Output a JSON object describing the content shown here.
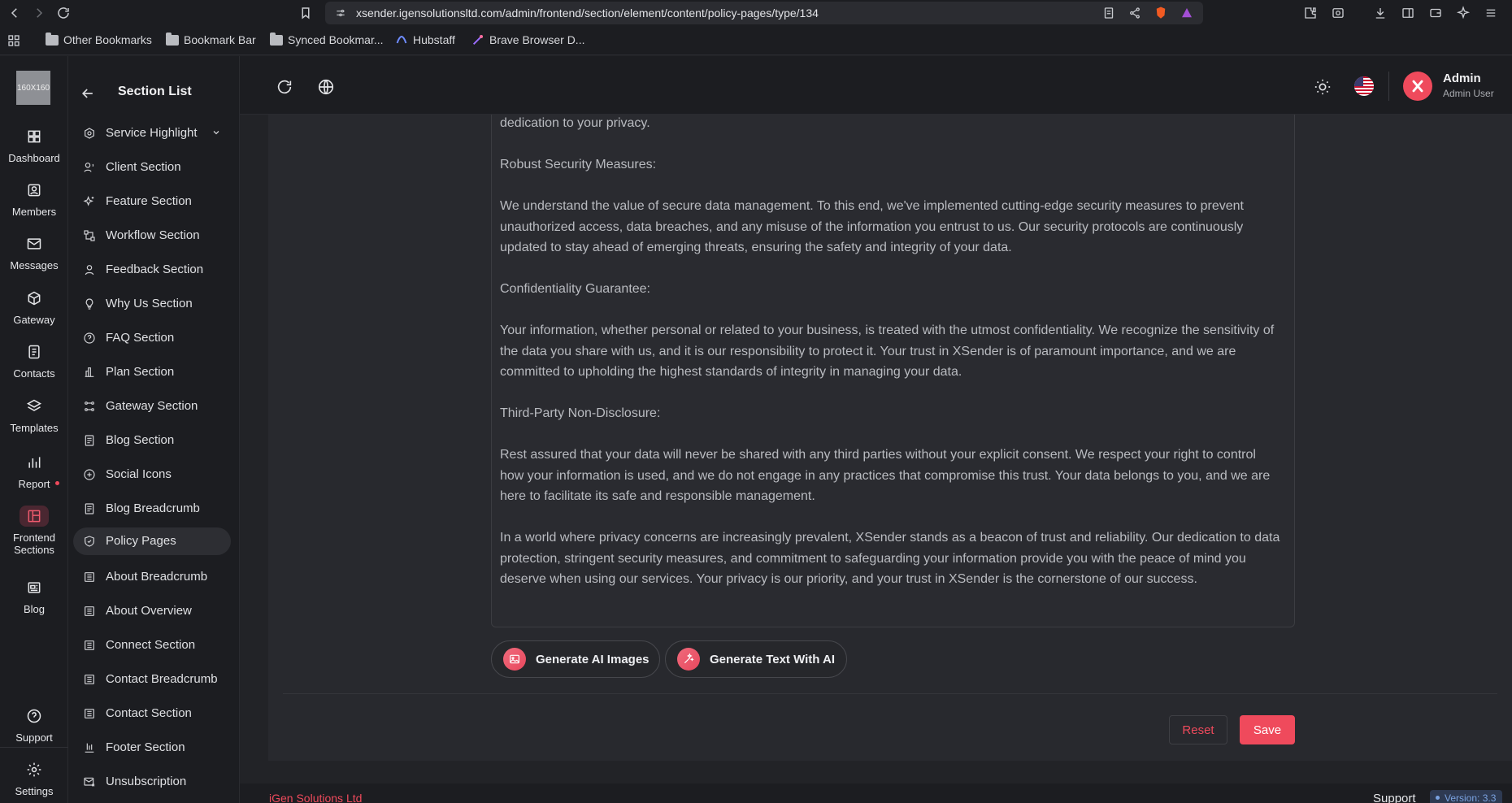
{
  "browser": {
    "url": "xsender.igensolutionsltd.com/admin/frontend/section/element/content/policy-pages/type/134",
    "bookmarks": [
      "Other Bookmarks",
      "Bookmark Bar",
      "Synced Bookmar...",
      "Hubstaff",
      "Brave Browser D..."
    ]
  },
  "rail": {
    "logo": "160X160",
    "items": [
      {
        "label": "Dashboard",
        "icon": "grid-icon"
      },
      {
        "label": "Members",
        "icon": "user-square-icon"
      },
      {
        "label": "Messages",
        "icon": "mail-icon"
      },
      {
        "label": "Gateway",
        "icon": "cube-icon"
      },
      {
        "label": "Contacts",
        "icon": "contacts-icon"
      },
      {
        "label": "Templates",
        "icon": "layers-icon"
      },
      {
        "label": "Report",
        "icon": "bar-chart-icon"
      },
      {
        "label": "Frontend",
        "label2": "Sections",
        "icon": "layout-icon"
      },
      {
        "label": "Blog",
        "icon": "newspaper-icon"
      }
    ],
    "bottom": [
      {
        "label": "Support",
        "icon": "help-icon"
      },
      {
        "label": "Settings",
        "icon": "gear-icon"
      }
    ]
  },
  "section_list": {
    "title": "Section List",
    "items": [
      {
        "label": "Service Highlight"
      },
      {
        "label": "Client Section"
      },
      {
        "label": "Feature Section"
      },
      {
        "label": "Workflow Section"
      },
      {
        "label": "Feedback Section"
      },
      {
        "label": "Why Us Section"
      },
      {
        "label": "FAQ Section"
      },
      {
        "label": "Plan Section"
      },
      {
        "label": "Gateway Section"
      },
      {
        "label": "Blog Section"
      },
      {
        "label": "Social Icons"
      },
      {
        "label": "Blog Breadcrumb"
      },
      {
        "label": "Policy Pages"
      },
      {
        "label": "About Breadcrumb"
      },
      {
        "label": "About Overview"
      },
      {
        "label": "Connect Section"
      },
      {
        "label": "Contact Breadcrumb"
      },
      {
        "label": "Contact Section"
      },
      {
        "label": "Footer Section"
      },
      {
        "label": "Unsubscription"
      }
    ],
    "active": "Policy Pages"
  },
  "header": {
    "user_name": "Admin",
    "user_role": "Admin User"
  },
  "editor": {
    "paragraphs": [
      "dedication to your privacy.",
      "Robust Security Measures:",
      "We understand the value of secure data management. To this end, we've implemented cutting-edge security measures to prevent unauthorized access, data breaches, and any misuse of the information you entrust to us. Our security protocols are continuously updated to stay ahead of emerging threats, ensuring the safety and integrity of your data.",
      "Confidentiality Guarantee:",
      "Your information, whether personal or related to your business, is treated with the utmost confidentiality. We recognize the sensitivity of the data you share with us, and it is our responsibility to protect it. Your trust in XSender is of paramount importance, and we are committed to upholding the highest standards of integrity in managing your data.",
      "Third-Party Non-Disclosure:",
      "Rest assured that your data will never be shared with any third parties without your explicit consent. We respect your right to control how your information is used, and we do not engage in any practices that compromise this trust. Your data belongs to you, and we are here to facilitate its safe and responsible management.",
      "In a world where privacy concerns are increasingly prevalent, XSender stands as a beacon of trust and reliability. Our dedication to data protection, stringent security measures, and commitment to safeguarding your information provide you with the peace of mind you deserve when using our services. Your privacy is our priority, and your trust in XSender is the cornerstone of our success."
    ]
  },
  "actions": {
    "ai_images": "Generate AI Images",
    "ai_text": "Generate Text With AI",
    "reset": "Reset",
    "save": "Save"
  },
  "footer": {
    "brand": "iGen Solutions Ltd",
    "support": "Support",
    "version": "Version: 3.3"
  },
  "colors": {
    "accent": "#ef4a5c",
    "background": "#222327",
    "panel": "#1c1d21"
  }
}
